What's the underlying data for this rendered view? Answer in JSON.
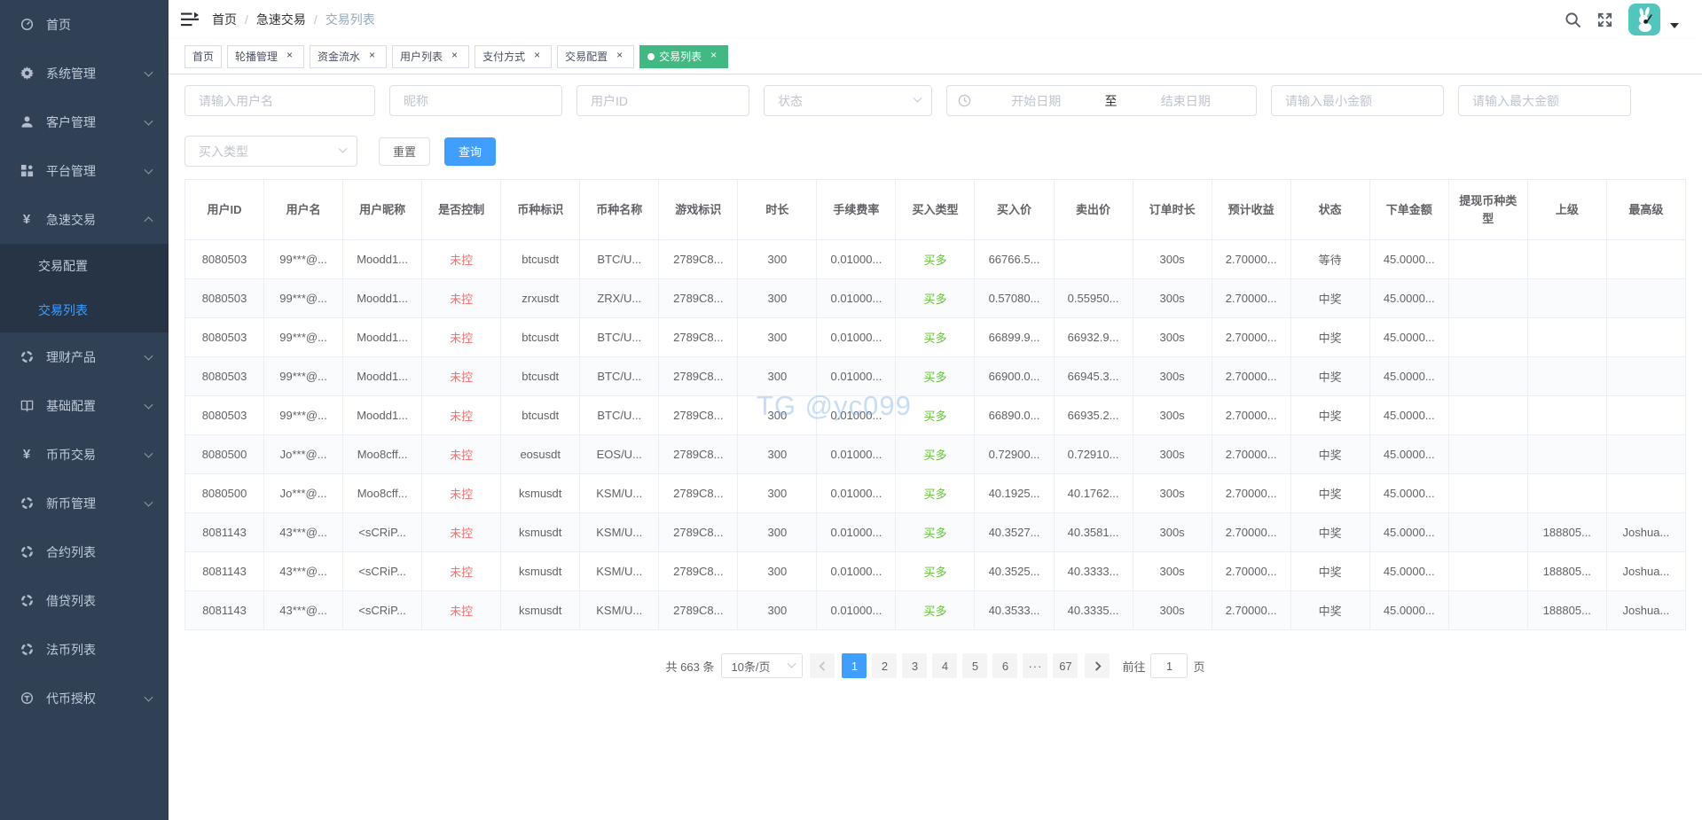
{
  "colors": {
    "accent": "#409eff",
    "active_tab_green": "#42b983",
    "sidebar_bg": "#304156",
    "submenu_bg": "#263445",
    "danger_text": "#f56c6c",
    "success_text": "#67c23a",
    "avatar_bg": "#52c5bd"
  },
  "sidebar": {
    "items": [
      {
        "label": "首页",
        "icon": "dashboard",
        "arrow": false
      },
      {
        "label": "系统管理",
        "icon": "gear",
        "arrow": true
      },
      {
        "label": "客户管理",
        "icon": "user",
        "arrow": true
      },
      {
        "label": "平台管理",
        "icon": "grid",
        "arrow": true
      },
      {
        "label": "急速交易",
        "icon": "yen",
        "arrow": true,
        "expanded": true,
        "children": [
          {
            "label": "交易配置",
            "active": false
          },
          {
            "label": "交易列表",
            "active": true
          }
        ]
      },
      {
        "label": "理财产品",
        "icon": "ring",
        "arrow": true
      },
      {
        "label": "基础配置",
        "icon": "book",
        "arrow": true
      },
      {
        "label": "币币交易",
        "icon": "yen",
        "arrow": true
      },
      {
        "label": "新币管理",
        "icon": "ring",
        "arrow": true
      },
      {
        "label": "合约列表",
        "icon": "ring",
        "arrow": false
      },
      {
        "label": "借贷列表",
        "icon": "ring",
        "arrow": false
      },
      {
        "label": "法币列表",
        "icon": "ring",
        "arrow": false
      },
      {
        "label": "代币授权",
        "icon": "token",
        "arrow": true
      }
    ]
  },
  "navbar": {
    "breadcrumb": [
      "首页",
      "急速交易",
      "交易列表"
    ]
  },
  "tabs": [
    {
      "label": "首页",
      "closable": false,
      "active": false
    },
    {
      "label": "轮播管理",
      "closable": true,
      "active": false
    },
    {
      "label": "资金流水",
      "closable": true,
      "active": false
    },
    {
      "label": "用户列表",
      "closable": true,
      "active": false
    },
    {
      "label": "支付方式",
      "closable": true,
      "active": false
    },
    {
      "label": "交易配置",
      "closable": true,
      "active": false
    },
    {
      "label": "交易列表",
      "closable": true,
      "active": true
    }
  ],
  "filters": {
    "username_placeholder": "请输入用户名",
    "nickname_placeholder": "昵称",
    "userid_placeholder": "用户ID",
    "status_placeholder": "状态",
    "date_start_placeholder": "开始日期",
    "date_separator": "至",
    "date_end_placeholder": "结束日期",
    "min_amount_placeholder": "请输入最小金额",
    "max_amount_placeholder": "请输入最大金额",
    "buy_type_placeholder": "买入类型",
    "reset_label": "重置",
    "search_label": "查询"
  },
  "table": {
    "columns": [
      "用户ID",
      "用户名",
      "用户昵称",
      "是否控制",
      "币种标识",
      "币种名称",
      "游戏标识",
      "时长",
      "手续费率",
      "买入类型",
      "买入价",
      "卖出价",
      "订单时长",
      "预计收益",
      "状态",
      "下单金额",
      "提现币种类型",
      "上级",
      "最高级"
    ],
    "rows": [
      [
        "8080503",
        "99***@...",
        "Moodd1...",
        "未控",
        "btcusdt",
        "BTC/U...",
        "2789C8...",
        "300",
        "0.01000...",
        "买多",
        "66766.5...",
        "",
        "300s",
        "2.70000...",
        "等待",
        "45.0000...",
        "",
        "",
        ""
      ],
      [
        "8080503",
        "99***@...",
        "Moodd1...",
        "未控",
        "zrxusdt",
        "ZRX/U...",
        "2789C8...",
        "300",
        "0.01000...",
        "买多",
        "0.57080...",
        "0.55950...",
        "300s",
        "2.70000...",
        "中奖",
        "45.0000...",
        "",
        "",
        ""
      ],
      [
        "8080503",
        "99***@...",
        "Moodd1...",
        "未控",
        "btcusdt",
        "BTC/U...",
        "2789C8...",
        "300",
        "0.01000...",
        "买多",
        "66899.9...",
        "66932.9...",
        "300s",
        "2.70000...",
        "中奖",
        "45.0000...",
        "",
        "",
        ""
      ],
      [
        "8080503",
        "99***@...",
        "Moodd1...",
        "未控",
        "btcusdt",
        "BTC/U...",
        "2789C8...",
        "300",
        "0.01000...",
        "买多",
        "66900.0...",
        "66945.3...",
        "300s",
        "2.70000...",
        "中奖",
        "45.0000...",
        "",
        "",
        ""
      ],
      [
        "8080503",
        "99***@...",
        "Moodd1...",
        "未控",
        "btcusdt",
        "BTC/U...",
        "2789C8...",
        "300",
        "0.01000...",
        "买多",
        "66890.0...",
        "66935.2...",
        "300s",
        "2.70000...",
        "中奖",
        "45.0000...",
        "",
        "",
        ""
      ],
      [
        "8080500",
        "Jo***@...",
        "Moo8cff...",
        "未控",
        "eosusdt",
        "EOS/U...",
        "2789C8...",
        "300",
        "0.01000...",
        "买多",
        "0.72900...",
        "0.72910...",
        "300s",
        "2.70000...",
        "中奖",
        "45.0000...",
        "",
        "",
        ""
      ],
      [
        "8080500",
        "Jo***@...",
        "Moo8cff...",
        "未控",
        "ksmusdt",
        "KSM/U...",
        "2789C8...",
        "300",
        "0.01000...",
        "买多",
        "40.1925...",
        "40.1762...",
        "300s",
        "2.70000...",
        "中奖",
        "45.0000...",
        "",
        "",
        ""
      ],
      [
        "8081143",
        "43***@...",
        "<sCRiP...",
        "未控",
        "ksmusdt",
        "KSM/U...",
        "2789C8...",
        "300",
        "0.01000...",
        "买多",
        "40.3527...",
        "40.3581...",
        "300s",
        "2.70000...",
        "中奖",
        "45.0000...",
        "",
        "188805...",
        "Joshua..."
      ],
      [
        "8081143",
        "43***@...",
        "<sCRiP...",
        "未控",
        "ksmusdt",
        "KSM/U...",
        "2789C8...",
        "300",
        "0.01000...",
        "买多",
        "40.3525...",
        "40.3333...",
        "300s",
        "2.70000...",
        "中奖",
        "45.0000...",
        "",
        "188805...",
        "Joshua..."
      ],
      [
        "8081143",
        "43***@...",
        "<sCRiP...",
        "未控",
        "ksmusdt",
        "KSM/U...",
        "2789C8...",
        "300",
        "0.01000...",
        "买多",
        "40.3533...",
        "40.3335...",
        "300s",
        "2.70000...",
        "中奖",
        "45.0000...",
        "",
        "188805...",
        "Joshua..."
      ]
    ],
    "control_value": "未控",
    "buy_type_value": "买多"
  },
  "pagination": {
    "total_text": "共 663 条",
    "page_size": "10条/页",
    "pages": [
      "1",
      "2",
      "3",
      "4",
      "5",
      "6"
    ],
    "more_pages": "···",
    "last_page": "67",
    "active_page": "1",
    "jumper_prefix": "前往",
    "jumper_value": "1",
    "jumper_suffix": "页"
  },
  "watermark": {
    "text": "TG @yc099"
  }
}
